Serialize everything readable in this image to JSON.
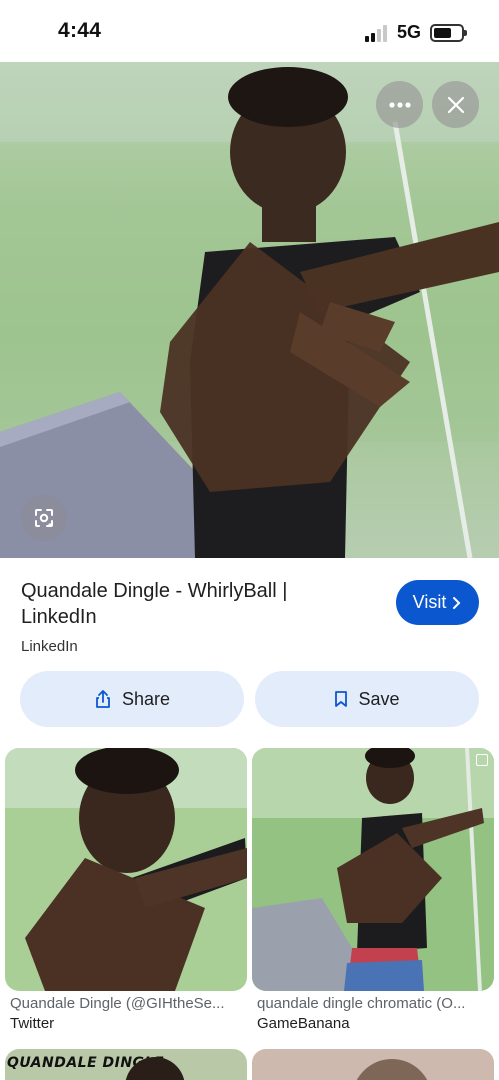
{
  "status_bar": {
    "time": "4:44",
    "network": "5G"
  },
  "icons": {
    "more": "more-horizontal-icon",
    "close": "close-icon",
    "lens": "lens-search-icon",
    "visit_chevron": "chevron-right-icon",
    "share": "share-icon",
    "save": "bookmark-icon"
  },
  "result": {
    "title": "Quandale Dingle - WhirlyBall | LinkedIn",
    "source": "LinkedIn",
    "visit_label": "Visit",
    "share_label": "Share",
    "save_label": "Save"
  },
  "related": [
    {
      "caption": "Quandale Dingle (@GIHtheSe...",
      "source": "Twitter"
    },
    {
      "caption": "quandale dingle chromatic (O...",
      "source": "GameBanana"
    },
    {
      "caption": "QUANDALE DINGLE",
      "source": ""
    },
    {
      "caption": "",
      "source": ""
    }
  ],
  "colors": {
    "accent": "#0b57d0",
    "button_bg": "#e3ecfb"
  }
}
